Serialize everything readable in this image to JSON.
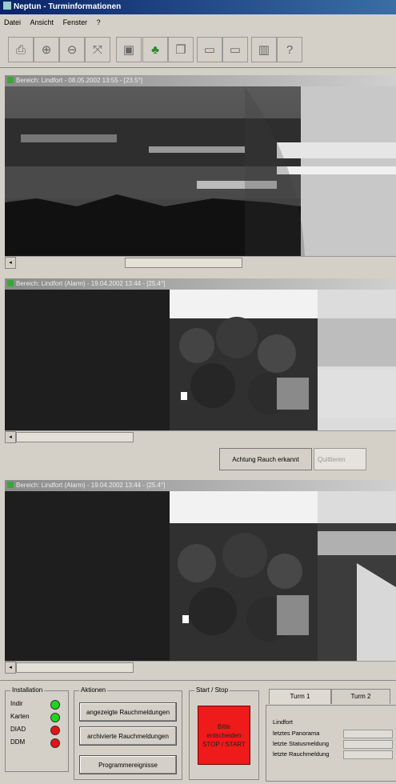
{
  "window": {
    "title": "Neptun - Turminformationen"
  },
  "menu": [
    "Datei",
    "Ansicht",
    "Fenster",
    "?"
  ],
  "toolbar": {
    "buttons": [
      {
        "name": "print-button",
        "glyph": "⎙"
      },
      {
        "name": "zoom-in-button",
        "glyph": "⊕"
      },
      {
        "name": "zoom-out-button",
        "glyph": "⊖"
      },
      {
        "name": "fit-button",
        "glyph": "⤧"
      },
      {
        "name": "camera-button",
        "glyph": "▣"
      },
      {
        "name": "tree-button",
        "glyph": "♣"
      },
      {
        "name": "copy-button",
        "glyph": "❐"
      },
      {
        "name": "window-button",
        "glyph": "▭"
      },
      {
        "name": "window2-button",
        "glyph": "▭"
      },
      {
        "name": "report-button",
        "glyph": "▥"
      },
      {
        "name": "help-button",
        "glyph": "?"
      }
    ]
  },
  "panels": [
    {
      "title": "Bereich: Lindfort - 08.05.2002 13:55 - [23.5°]"
    },
    {
      "title": "Bereich: Lindfort (Alarm) - 19.04.2002 13:44 - [25.4°]"
    },
    {
      "title": "Bereich: Lindfort (Alarm) - 19.04.2002 13:44 - [25.4°]"
    }
  ],
  "alarm": {
    "label": "Achtung Rauch erkannt",
    "secondary": "Quittieren"
  },
  "installation": {
    "title": "Installation",
    "items": [
      {
        "label": "Indir",
        "color": "#1fd51f"
      },
      {
        "label": "Karten",
        "color": "#1fd51f"
      },
      {
        "label": "DIAD",
        "color": "#e51313"
      },
      {
        "label": "DDM",
        "color": "#e51313"
      }
    ]
  },
  "actions": {
    "title": "Aktionen",
    "buttons": [
      "angezeigte Rauchmeldungen",
      "archivierte Rauchmeldungen",
      "Programmereignisse"
    ]
  },
  "startstop": {
    "title": "Start / Stop",
    "lines": [
      "Bitte",
      "entscheiden",
      "STOP / START"
    ]
  },
  "tabs": [
    "Turm 1",
    "Turm 2"
  ],
  "info": {
    "title": "Lindfort",
    "rows": [
      "letztes Panorama",
      "letzte Statusmeldung",
      "letzte Rauchmeldung"
    ]
  },
  "colors": {
    "accent": "#0a246a",
    "stop": "#ef1a1a",
    "led_on": "#1fd51f",
    "led_off": "#e51313"
  }
}
